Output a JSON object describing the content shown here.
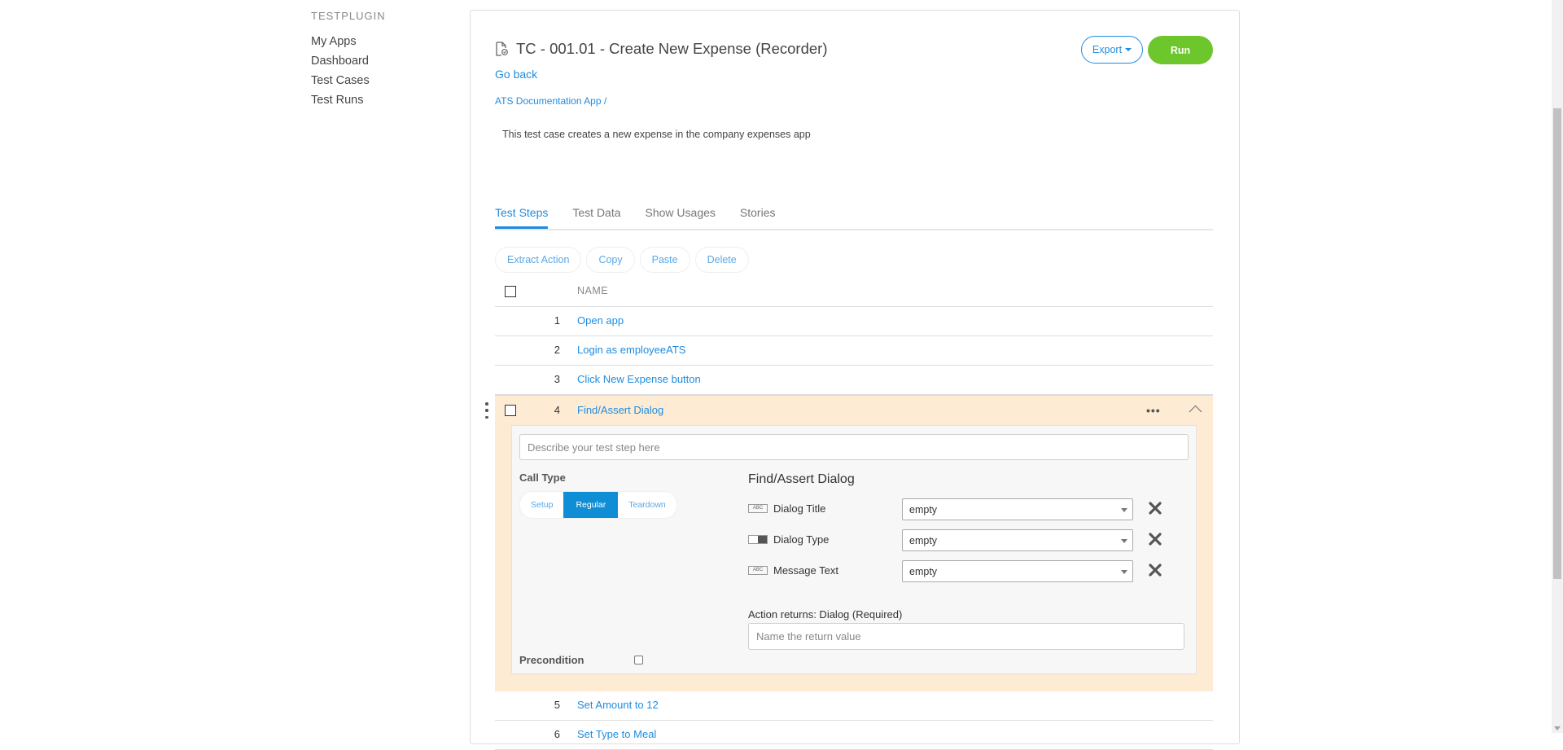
{
  "nav": {
    "header": "TESTPLUGIN",
    "items": [
      "My Apps",
      "Dashboard",
      "Test Cases",
      "Test Runs"
    ]
  },
  "page": {
    "title": "TC - 001.01 - Create New Expense (Recorder)",
    "go_back": "Go back",
    "breadcrumb": "ATS Documentation App /",
    "description": "This test case creates a new expense in the company expenses app",
    "export_label": "Export",
    "run_label": "Run"
  },
  "tabs": [
    "Test Steps",
    "Test Data",
    "Show Usages",
    "Stories"
  ],
  "active_tab": "Test Steps",
  "toolbar": {
    "extract": "Extract Action",
    "copy": "Copy",
    "paste": "Paste",
    "delete": "Delete"
  },
  "table": {
    "name_header": "NAME",
    "rows": [
      {
        "num": "1",
        "name": "Open app"
      },
      {
        "num": "2",
        "name": "Login as employeeATS"
      },
      {
        "num": "3",
        "name": "Click New Expense button"
      },
      {
        "num": "4",
        "name": "Find/Assert Dialog"
      },
      {
        "num": "5",
        "name": "Set Amount to 12"
      },
      {
        "num": "6",
        "name": "Set Type to Meal"
      }
    ]
  },
  "detail": {
    "description_placeholder": "Describe your test step here",
    "call_type_label": "Call Type",
    "call_types": [
      "Setup",
      "Regular",
      "Teardown"
    ],
    "active_call_type": "Regular",
    "action_title": "Find/Assert Dialog",
    "params": [
      {
        "name": "Dialog Title",
        "type_icon": "abc-text-icon",
        "tag": "ABC",
        "value": "empty"
      },
      {
        "name": "Dialog Type",
        "type_icon": "dropdown-type-icon",
        "tag": "",
        "value": "empty"
      },
      {
        "name": "Message Text",
        "type_icon": "abc-text-icon",
        "tag": "ABC",
        "value": "empty"
      }
    ],
    "returns_label": "Action returns: Dialog (Required)",
    "return_placeholder": "Name the return value",
    "precondition_label": "Precondition"
  },
  "colors": {
    "accent": "#1f8ce0",
    "run_green": "#6cc62c",
    "expanded_row_bg": "#fdebd3",
    "regular_active": "#0f8ed6"
  }
}
